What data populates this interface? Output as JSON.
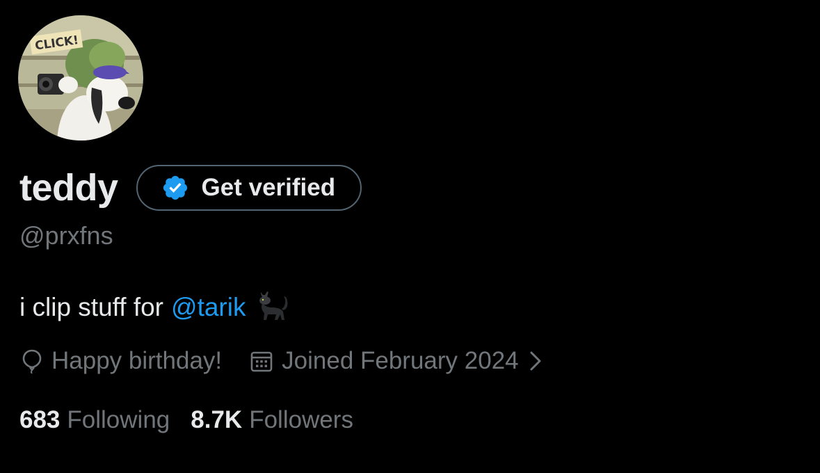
{
  "profile": {
    "avatar_sticker_text": "CLICK!",
    "display_name": "teddy",
    "handle": "@prxfns",
    "bio": {
      "text": "i clip stuff for",
      "mention": "@tarik",
      "emoji": "cat"
    },
    "verify_button": {
      "label": "Get verified",
      "badge_icon": "verified-badge-icon"
    },
    "birthday": {
      "icon": "balloon-icon",
      "text": "Happy birthday!"
    },
    "joined": {
      "icon": "calendar-icon",
      "text": "Joined February 2024",
      "chevron_icon": "chevron-right-icon"
    },
    "stats": {
      "following_count": "683",
      "following_label": "Following",
      "followers_count": "8.7K",
      "followers_label": "Followers"
    }
  },
  "colors": {
    "background": "#000000",
    "primary_text": "#e7e9ea",
    "secondary_text": "#71767b",
    "accent": "#1d9bf0",
    "border": "#536471"
  }
}
